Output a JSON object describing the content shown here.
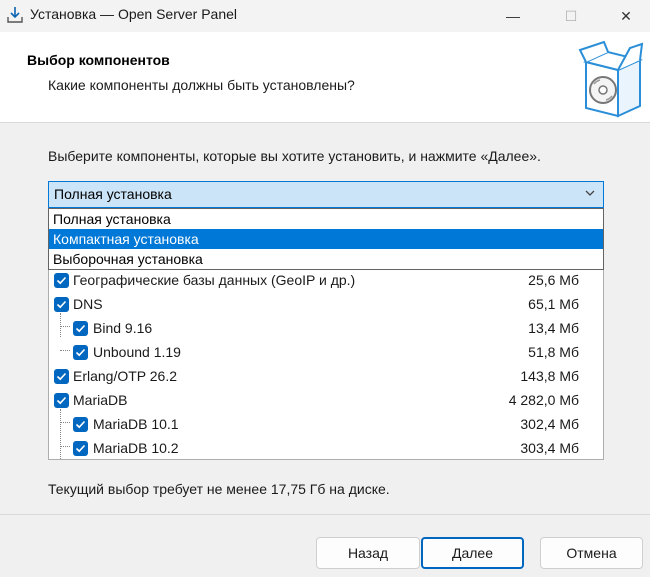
{
  "window": {
    "title": "Установка — Open Server Panel",
    "minimize_glyph": "—",
    "maximize_glyph": "☐",
    "close_glyph": "✕"
  },
  "header": {
    "title": "Выбор компонентов",
    "subtitle": "Какие компоненты должны быть установлены?"
  },
  "instruction": "Выберите компоненты, которые вы хотите установить, и нажмите «Далее».",
  "install_type": {
    "selected": "Полная установка",
    "options": [
      "Полная установка",
      "Компактная установка",
      "Выборочная установка"
    ],
    "highlighted_option": "Компактная установка"
  },
  "components": [
    {
      "name": "Географические базы данных (GeoIP и др.)",
      "size": "25,6 Мб",
      "checked": true,
      "level": 0
    },
    {
      "name": "DNS",
      "size": "65,1 Мб",
      "checked": true,
      "level": 0
    },
    {
      "name": "Bind 9.16",
      "size": "13,4 Мб",
      "checked": true,
      "level": 1
    },
    {
      "name": "Unbound 1.19",
      "size": "51,8 Мб",
      "checked": true,
      "level": 1
    },
    {
      "name": "Erlang/OTP 26.2",
      "size": "143,8 Мб",
      "checked": true,
      "level": 0
    },
    {
      "name": "MariaDB",
      "size": "4 282,0 Мб",
      "checked": true,
      "level": 0
    },
    {
      "name": "MariaDB 10.1",
      "size": "302,4 Мб",
      "checked": true,
      "level": 1
    },
    {
      "name": "MariaDB 10.2",
      "size": "303,4 Мб",
      "checked": true,
      "level": 1
    }
  ],
  "disk_requirement": "Текущий выбор требует не менее 17,75 Гб на диске.",
  "buttons": {
    "back": "Назад",
    "next": "Далее",
    "cancel": "Отмена"
  },
  "colors": {
    "accent": "#0067c0",
    "selection": "#0078d7",
    "combo_bg": "#cce4f7"
  }
}
